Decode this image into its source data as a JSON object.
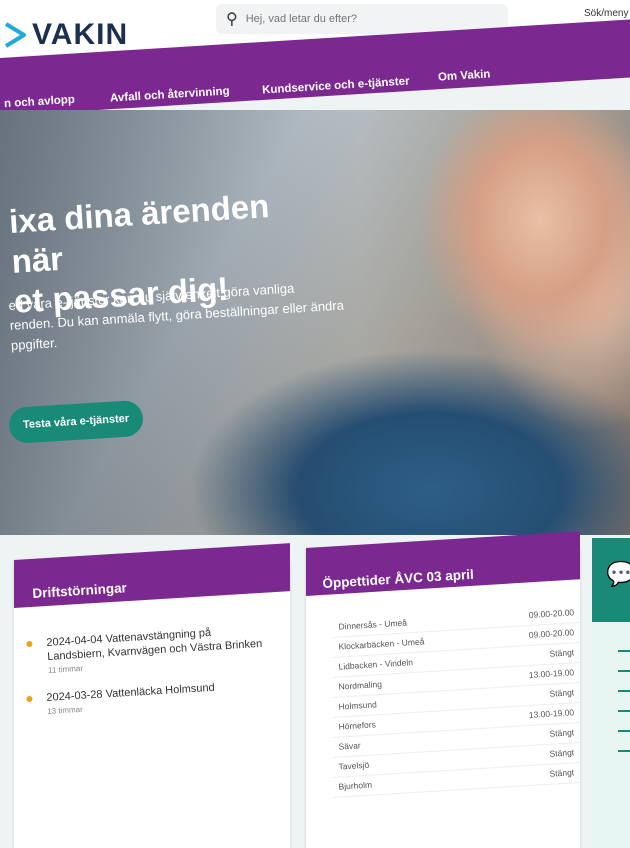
{
  "header": {
    "logo_text": "VAKIN",
    "search_placeholder": "Hej, vad letar du efter?",
    "login_label": "Sök/meny"
  },
  "nav": {
    "items": [
      "n och avlopp",
      "Avfall och återvinning",
      "Kundservice och e-tjänster",
      "Om Vakin"
    ]
  },
  "hero": {
    "title_line1": "ixa dina ärenden när",
    "title_line2": "et passar dig!",
    "text_line1": "ed våra e-tjänster kan du själv enkelt göra vanliga",
    "text_line2": "renden. Du kan anmäla flytt, göra beställningar eller ändra",
    "text_line3": "ppgifter.",
    "button_label": "Testa våra e-tjänster"
  },
  "disturbances": {
    "title": "Driftstörningar",
    "items": [
      {
        "title": "2024-04-04 Vattenavstängning på Landsbiern, Kvarnvägen och Västra Brinken",
        "meta": "11 timmar"
      },
      {
        "title": "2024-03-28 Vattenläcka Holmsund",
        "meta": "13 timmar"
      }
    ]
  },
  "opening_hours": {
    "title": "Öppettider ÅVC 03 april",
    "rows": [
      {
        "name": "Dinnersås - Umeå",
        "value": "09.00-20.00"
      },
      {
        "name": "Klockarbäcken - Umeå",
        "value": "09.00-20.00"
      },
      {
        "name": "Lidbacken - Vindeln",
        "value": "Stängt"
      },
      {
        "name": "Nordmaling",
        "value": "13.00-19.00"
      },
      {
        "name": "Holmsund",
        "value": "Stängt"
      },
      {
        "name": "Hörnefors",
        "value": "13.00-19.00"
      },
      {
        "name": "Sävar",
        "value": "Stängt"
      },
      {
        "name": "Tavelsjö",
        "value": "Stängt"
      },
      {
        "name": "Bjurholm",
        "value": "Stängt"
      }
    ]
  },
  "colors": {
    "brand_purple": "#7b2891",
    "accent_teal": "#1a8a78",
    "logo_blue": "#1d2f4f",
    "dot_orange": "#f0a01c"
  },
  "icons": {
    "search": "search-icon",
    "chat": "chat-icon",
    "logo": "logo-arrow-icon"
  }
}
